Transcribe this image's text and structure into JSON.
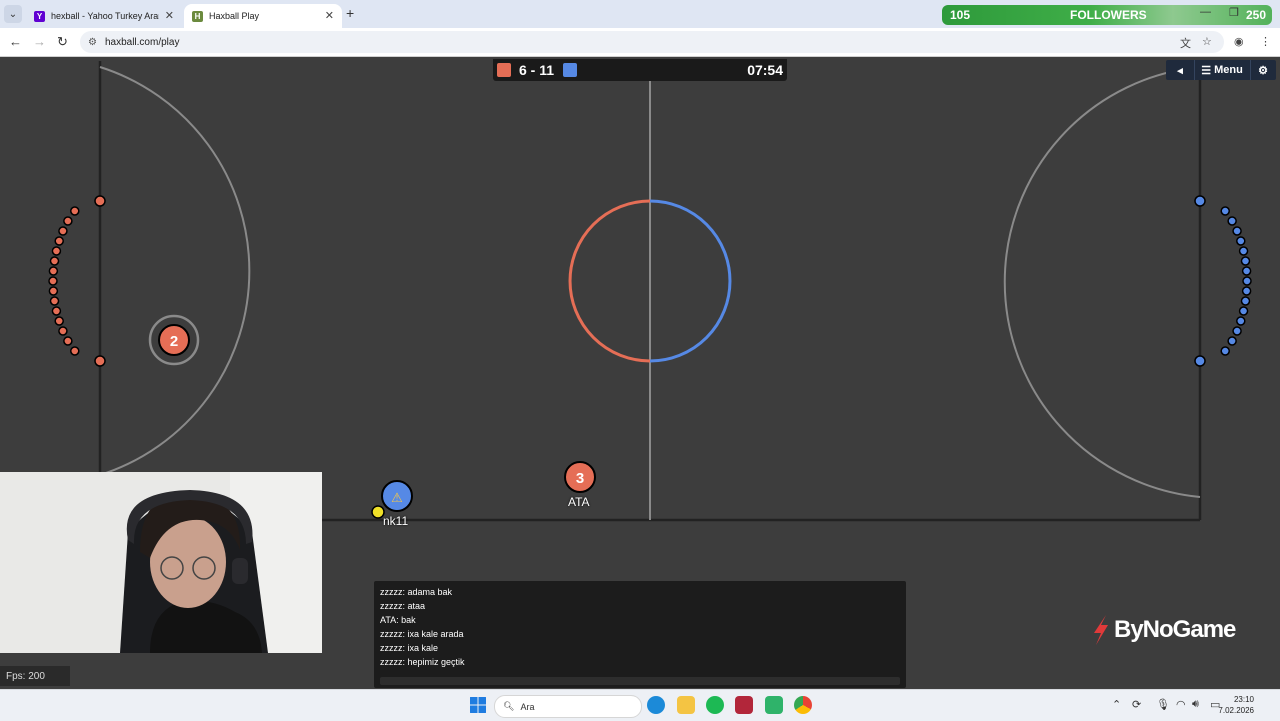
{
  "browser": {
    "tabs": [
      {
        "title": "hexball - Yahoo Turkey Arama S",
        "favicon_letter": "Y",
        "favicon_color": "#6001d2"
      },
      {
        "title": "Haxball Play",
        "favicon_letter": "H",
        "favicon_color": "#6b8a3e"
      }
    ],
    "url": "haxball.com/play"
  },
  "overlay": {
    "followers_count": "105",
    "followers_label": "FOLLOWERS",
    "followers_goal": "250"
  },
  "game": {
    "red_score": "6",
    "score_separator": "-",
    "blue_score": "11",
    "score_text": "6 - 11",
    "timer": "07:54",
    "menu_label": "Menu",
    "red_color": "#e56e56",
    "blue_color": "#5689e5",
    "players": [
      {
        "number": "2",
        "team": "red",
        "name": ""
      },
      {
        "number": "3",
        "team": "red",
        "name": "ATA"
      },
      {
        "number": "⚠",
        "team": "blue",
        "name": "nk11"
      }
    ]
  },
  "chat": {
    "messages": [
      "zzzzz: adama bak",
      "zzzzz: ataa",
      "ATA: bak",
      "zzzzz: ixa kale arada",
      "zzzzz: ixa kale",
      "zzzzz: hepimiz geçtik"
    ]
  },
  "stats": {
    "fps": "Fps: 200"
  },
  "watermark": "ByNoGame",
  "taskbar": {
    "search_placeholder": "Ara",
    "time": "23:10",
    "date": "7.02.2026"
  }
}
